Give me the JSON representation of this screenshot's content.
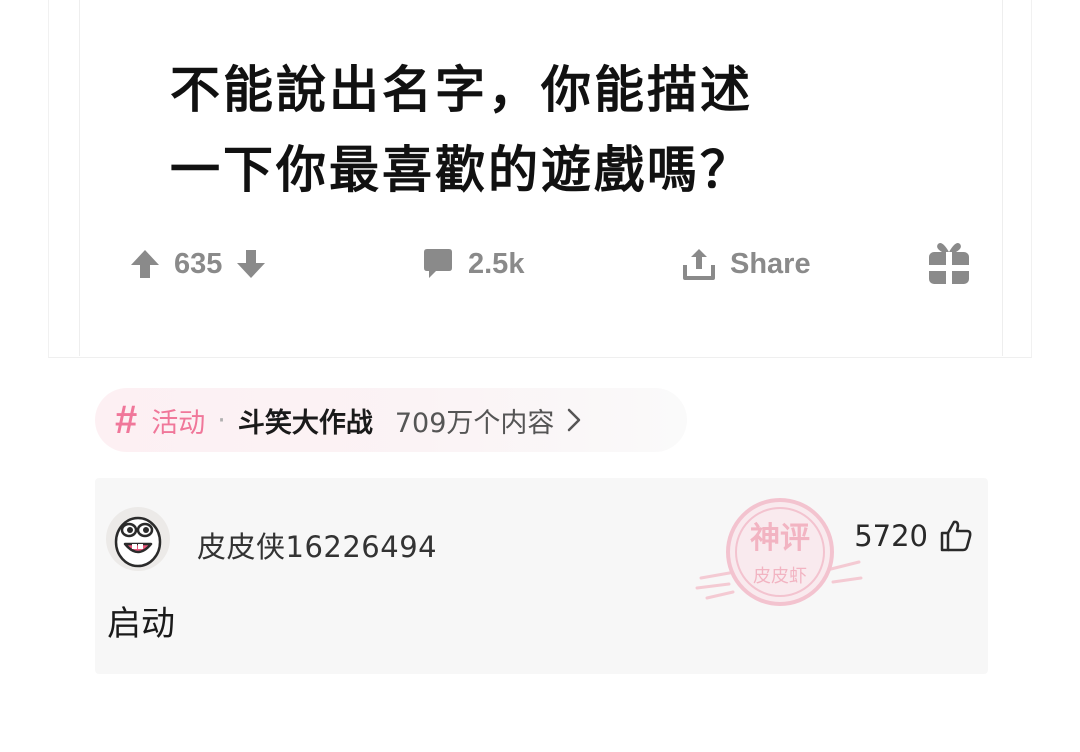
{
  "post": {
    "title_line1": "不能說出名字，你能描述",
    "title_line2": "一下你最喜歡的遊戲嗎？",
    "votes": "635",
    "comments": "2.5k",
    "share_label": "Share"
  },
  "topic": {
    "hash": "#",
    "category": "活动",
    "separator": "·",
    "name": "斗笑大作战",
    "count": "709万个内容"
  },
  "comment": {
    "username": "皮皮侠16226494",
    "likes": "5720",
    "text": "启动",
    "watermark_line1": "神评",
    "watermark_line2": "皮皮虾"
  },
  "colors": {
    "accent_pink": "#f0779a",
    "icon_gray": "#8a8a8a",
    "comment_bg": "#f7f7f7"
  },
  "icons": [
    "upvote-icon",
    "downvote-icon",
    "comment-icon",
    "share-icon",
    "award-icon",
    "chevron-right-icon",
    "thumbs-up-icon"
  ]
}
